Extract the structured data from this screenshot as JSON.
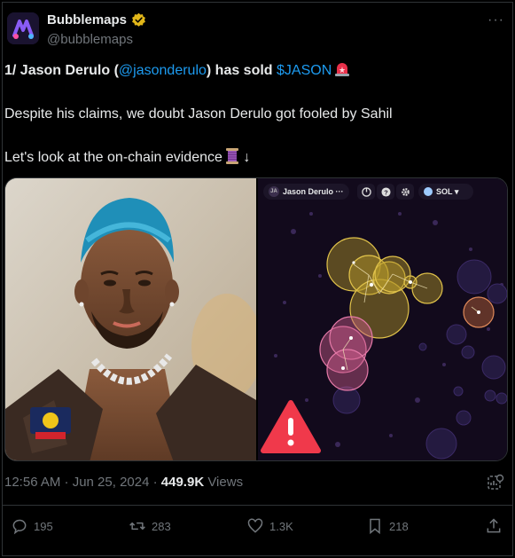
{
  "author": {
    "name": "Bubblemaps",
    "handle": "@bubblemaps"
  },
  "tweet": {
    "line1_prefix": "1/ Jason Derulo (",
    "line1_mention": "@jasonderulo",
    "line1_mid": ") has sold ",
    "line1_cashtag": "$JASON",
    "line2": "Despite his claims, we doubt Jason Derulo got fooled by Sahil",
    "line3": "Let's look at the on-chain evidence"
  },
  "media": {
    "bubblemap": {
      "token_label": "Jason Derulo ···",
      "token_icon": "JA",
      "chain": "SOL ▾"
    }
  },
  "meta": {
    "time": "12:56 AM · Jun 25, 2024 · ",
    "views_count": "449.9K",
    "views_label": " Views"
  },
  "actions": {
    "replies": "195",
    "reposts": "283",
    "likes": "1.3K",
    "bookmarks": "218"
  },
  "colors": {
    "accent": "#1d9bf0",
    "verified": "#e2b719",
    "muted": "#71767b",
    "text": "#e7e9ea",
    "warning": "#f0394b"
  },
  "icons": [
    "more-icon",
    "verified-badge-icon",
    "siren-emoji",
    "thread-emoji",
    "analytics-icon",
    "reply-icon",
    "repost-icon",
    "like-icon",
    "bookmark-icon",
    "share-icon",
    "warning-icon"
  ]
}
